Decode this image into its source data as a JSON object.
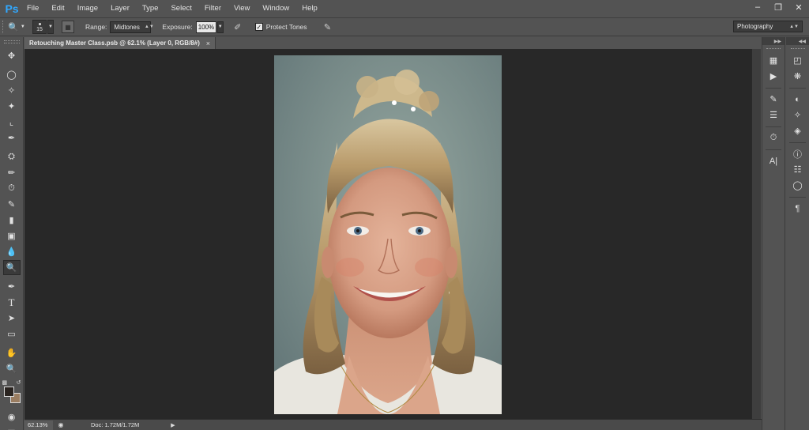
{
  "app": {
    "logo": "Ps",
    "menu": [
      "File",
      "Edit",
      "Image",
      "Layer",
      "Type",
      "Select",
      "Filter",
      "View",
      "Window",
      "Help"
    ],
    "window_controls": [
      "minimize-icon",
      "restore-icon",
      "close-icon"
    ]
  },
  "options": {
    "brush_size": "15",
    "range_label": "Range:",
    "range_value": "Midtones",
    "exposure_label": "Exposure:",
    "exposure_value": "100%",
    "protect_tones_checked": true,
    "protect_tones_label": "Protect Tones",
    "workspace": "Photography"
  },
  "document": {
    "tab_title": "Retouching Master Class.psb @ 62.1% (Layer 0, RGB/8#)",
    "tab_close": "×"
  },
  "status": {
    "zoom": "62.13%",
    "doc_info": "Doc: 1.72M/1.72M"
  },
  "toolbar": {
    "tools": [
      "move-icon",
      "marquee-icon",
      "lasso-icon",
      "magic-wand-icon",
      "crop-icon",
      "eyedropper-icon",
      "healing-brush-icon",
      "brush-icon",
      "clone-stamp-icon",
      "history-brush-icon",
      "eraser-icon",
      "gradient-icon",
      "blur-icon",
      "dodge-icon",
      "pen-icon",
      "type-icon",
      "path-selection-icon",
      "rectangle-icon",
      "hand-icon",
      "zoom-icon"
    ],
    "active_tool": "dodge-icon",
    "foreground_color": "#2a2420",
    "background_color": "#9a7d61"
  },
  "panels": {
    "strip1": [
      "history-icon",
      "actions-icon",
      "brush-presets-icon",
      "adjust-icon",
      "clone-source-icon",
      "character-icon"
    ],
    "strip2": [
      "color-icon",
      "swatches-icon",
      "adjustments-icon",
      "paths-icon",
      "layers-icon",
      "info-icon",
      "channels-icon",
      "properties-icon",
      "paragraph-icon"
    ]
  }
}
